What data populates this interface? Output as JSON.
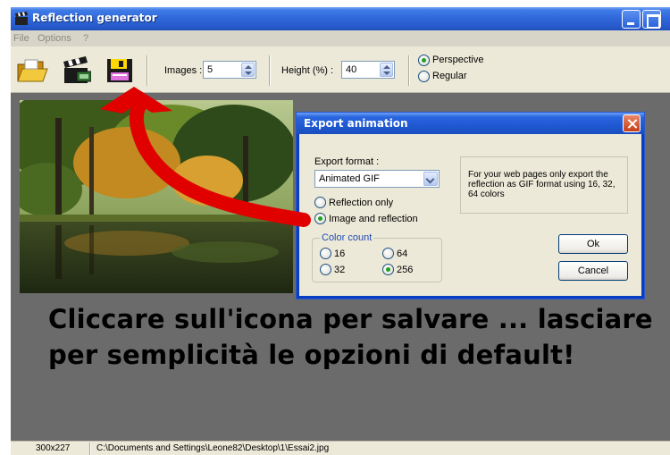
{
  "window": {
    "title": "Reflection generator"
  },
  "menu": [
    "File",
    "Options",
    "?"
  ],
  "toolbar": {
    "icons": [
      "open-folder-icon",
      "film-clapper-icon",
      "floppy-disk-save-icon"
    ],
    "images_label": "Images :",
    "images_value": "5",
    "height_label": "Height (%) :",
    "height_value": "40",
    "mode_options": [
      {
        "label": "Perspective",
        "selected": true
      },
      {
        "label": "Regular",
        "selected": false
      }
    ]
  },
  "dialog": {
    "title": "Export animation",
    "format_label": "Export format :",
    "format_value": "Animated GIF",
    "content_options": [
      {
        "label": "Reflection only",
        "selected": false
      },
      {
        "label": "Image and reflection",
        "selected": true
      }
    ],
    "color_group_label": "Color count",
    "colors": [
      {
        "label": "16",
        "selected": false
      },
      {
        "label": "64",
        "selected": false
      },
      {
        "label": "32",
        "selected": false
      },
      {
        "label": "256",
        "selected": true
      }
    ],
    "info_text": "For your web pages only export the reflection as GIF format using 16, 32, 64 colors",
    "ok_label": "Ok",
    "cancel_label": "Cancel"
  },
  "caption": {
    "line1": "Cliccare sull'icona per salvare ... lasciare",
    "line2": "per semplicità le opzioni di default!"
  },
  "status": {
    "size": "300x227",
    "path": "C:\\Documents and Settings\\Leone82\\Desktop\\1\\Essai2.jpg"
  },
  "colors": {
    "titlebar": "#2f67d8",
    "annotation_arrow": "#e00000",
    "workspace": "#6b6b6b"
  }
}
